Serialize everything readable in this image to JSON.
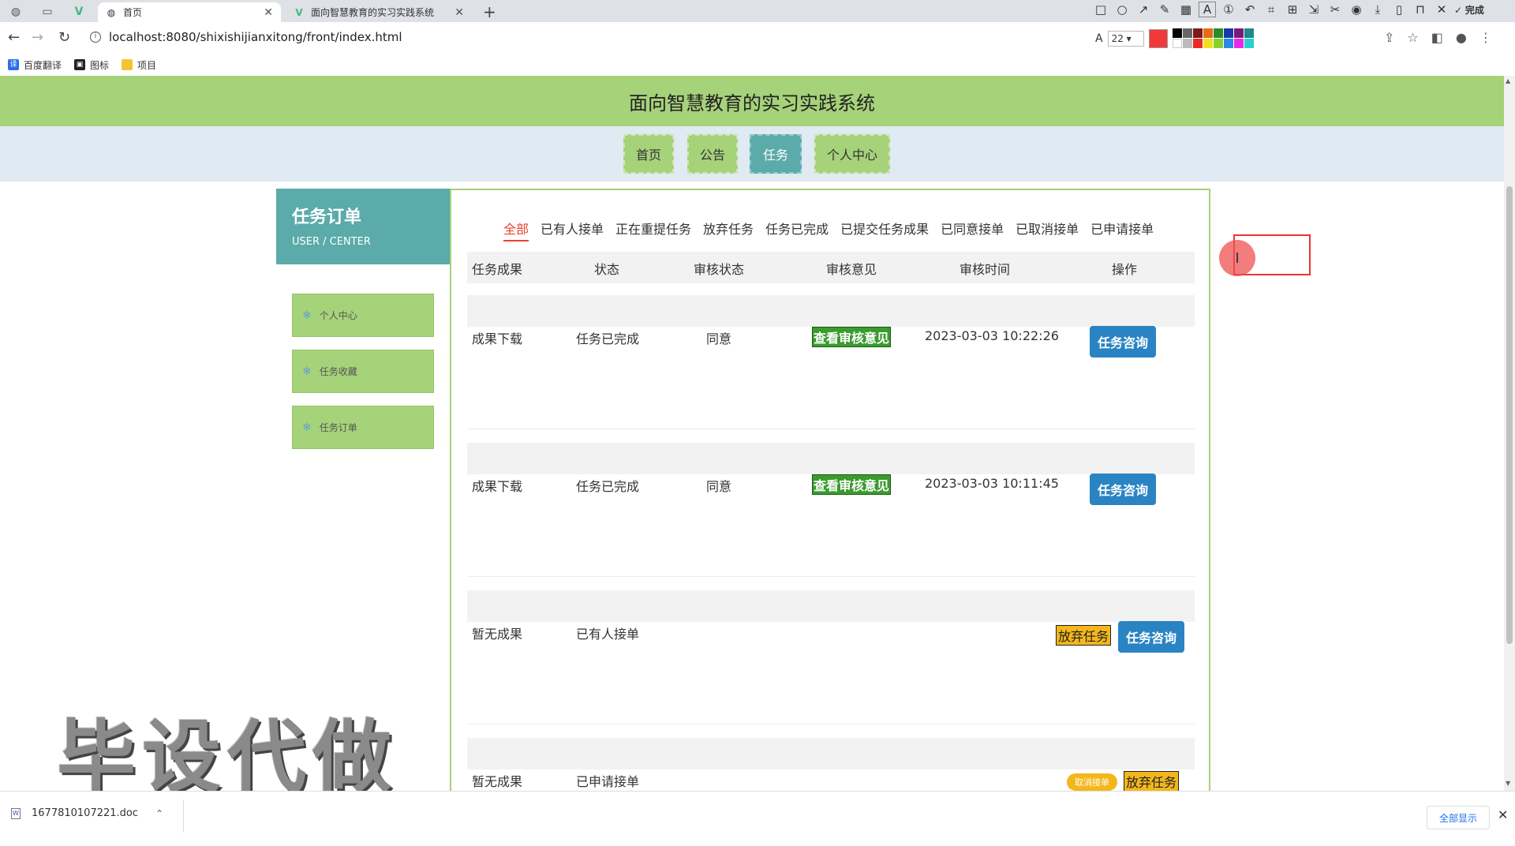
{
  "browser": {
    "tabs": [
      {
        "title": "首页",
        "favicon": "globe-icon",
        "active": true
      },
      {
        "title": "面向智慧教育的实习实践系统",
        "favicon": "vue-icon",
        "active": false
      }
    ],
    "url": "localhost:8080/shixishijianxitong/front/index.html",
    "bookmarks": [
      "百度翻译",
      "图标",
      "项目"
    ],
    "annotation_toolbar": {
      "done_label": "完成",
      "font_size": "22",
      "current_color": "#f03a3a"
    }
  },
  "site": {
    "title": "面向智慧教育的实习实践系统",
    "nav": [
      {
        "label": "首页",
        "active": false
      },
      {
        "label": "公告",
        "active": false
      },
      {
        "label": "任务",
        "active": true
      },
      {
        "label": "个人中心",
        "active": false
      }
    ],
    "colors": {
      "green": "#a6d279",
      "teal": "#5aaba9",
      "nav_bg": "#dfeaf3"
    }
  },
  "sidebar": {
    "title": "任务订单",
    "subtitle": "USER / CENTER",
    "items": [
      "个人中心",
      "任务收藏",
      "任务订单"
    ]
  },
  "orders": {
    "filters": [
      {
        "label": "全部",
        "active": true
      },
      {
        "label": "已有人接单",
        "active": false
      },
      {
        "label": "正在重提任务",
        "active": false
      },
      {
        "label": "放弃任务",
        "active": false
      },
      {
        "label": "任务已完成",
        "active": false
      },
      {
        "label": "已提交任务成果",
        "active": false
      },
      {
        "label": "已同意接单",
        "active": false
      },
      {
        "label": "已取消接单",
        "active": false
      },
      {
        "label": "已申请接单",
        "active": false
      }
    ],
    "columns": [
      "任务成果",
      "状态",
      "审核状态",
      "审核意见",
      "审核时间",
      "操作"
    ],
    "rows": [
      {
        "result": "成果下载",
        "status": "任务已完成",
        "audit": "同意",
        "opinion_btn": "查看审核意见",
        "time": "2023-03-03 10:22:26",
        "actions": [
          "任务咨询"
        ]
      },
      {
        "result": "成果下载",
        "status": "任务已完成",
        "audit": "同意",
        "opinion_btn": "查看审核意见",
        "time": "2023-03-03 10:11:45",
        "actions": [
          "任务咨询"
        ]
      },
      {
        "result": "暂无成果",
        "status": "已有人接单",
        "audit": "",
        "opinion_btn": "",
        "time": "",
        "actions": [
          "放弃任务",
          "任务咨询"
        ]
      },
      {
        "result": "暂无成果",
        "status": "已申请接单",
        "audit": "",
        "opinion_btn": "",
        "time": "",
        "actions": [
          "取消接单",
          "放弃任务"
        ]
      }
    ]
  },
  "watermark": "毕设代做",
  "downloads": {
    "file": "1677810107221.doc",
    "show_all": "全部显示"
  }
}
